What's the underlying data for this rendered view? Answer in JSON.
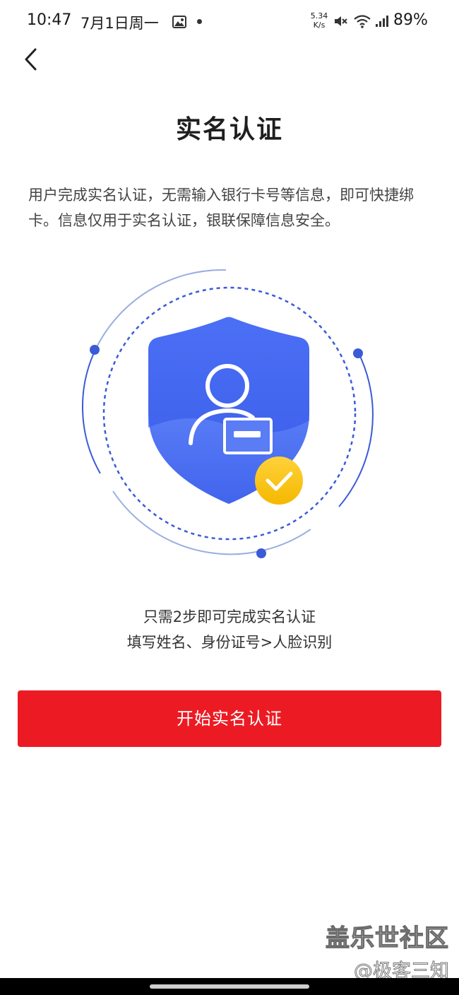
{
  "status_bar": {
    "time": "10:47",
    "date": "7月1日周一",
    "net_speed_value": "5.34",
    "net_speed_unit": "K/s",
    "battery": "89%",
    "icons": [
      "gallery-icon",
      "mute-icon",
      "wifi-icon",
      "signal-icon"
    ]
  },
  "header": {
    "back_icon": "chevron-left-icon",
    "title": "实名认证"
  },
  "intro": {
    "text": "用户完成实名认证，无需输入银行卡号等信息，即可快捷绑卡。信息仅用于实名认证，银联保障信息安全。"
  },
  "illustration": {
    "icons": [
      "shield-icon",
      "user-icon",
      "id-card-icon",
      "check-icon"
    ],
    "colors": {
      "shield": "#4a6cf0",
      "ring": "#3b5bd6",
      "check_badge": "#f6c21c"
    }
  },
  "steps": {
    "line1": "只需2步即可完成实名认证",
    "line2": "填写姓名、身份证号>人脸识别"
  },
  "action": {
    "start_label": "开始实名认证",
    "color": "#ec1b23"
  },
  "watermark": {
    "line1": "盖乐世社区",
    "line2": "@极客三知"
  }
}
